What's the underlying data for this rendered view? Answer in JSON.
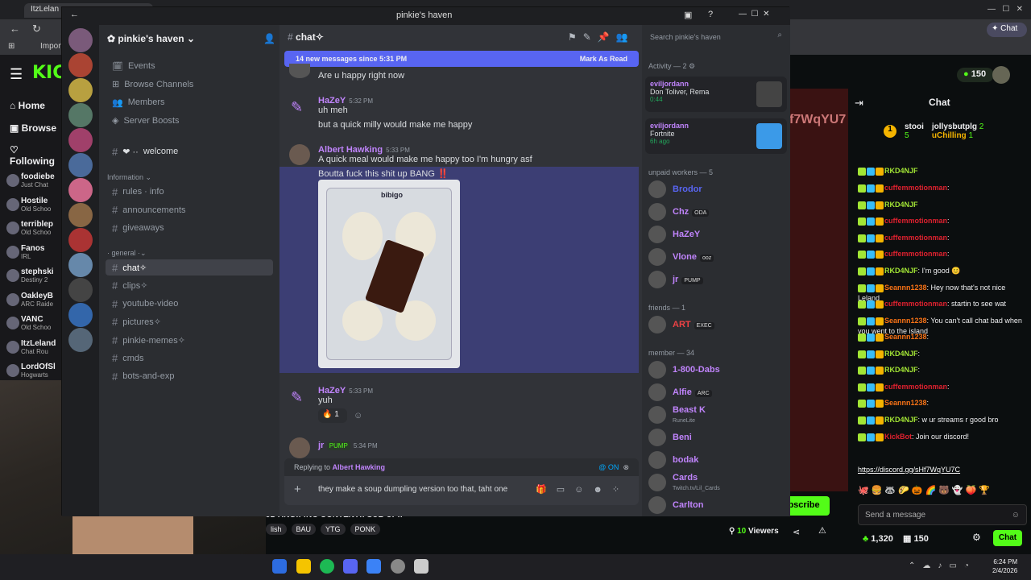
{
  "browser": {
    "tab_title": "ItzLelan",
    "bookmark_import": "Import"
  },
  "kick": {
    "logo": "KICK",
    "nav": [
      "Home",
      "Browse",
      "Following"
    ],
    "following": [
      {
        "name": "foodiebe",
        "game": "Just Chat"
      },
      {
        "name": "Hostile",
        "game": "Old Schoo"
      },
      {
        "name": "terriblep",
        "game": "Old Schoo"
      },
      {
        "name": "Fanos",
        "game": "IRL"
      },
      {
        "name": "stephski",
        "game": "Destiny 2"
      },
      {
        "name": "OakleyB",
        "game": "ARC Raide"
      },
      {
        "name": "VANC",
        "game": "Old Schoo"
      },
      {
        "name": "ItzLeland",
        "game": "Chat Rou"
      },
      {
        "name": "LordOfSl",
        "game": "Hogwarts"
      }
    ],
    "points": "150",
    "chat_title": "Chat",
    "top_gifters": [
      {
        "rank": "1",
        "name": "stooi",
        "count": "5"
      },
      {
        "name": "jollysbutplg",
        "count": "2"
      },
      {
        "name": "uChilling",
        "count": "1"
      }
    ],
    "chat": [
      {
        "user": "RKD4NJF",
        "text": "",
        "color": "#a3e635"
      },
      {
        "user": "cuffemmotionman",
        "text": ":",
        "color": "#e0212f"
      },
      {
        "user": "RKD4NJF",
        "text": "",
        "color": "#a3e635"
      },
      {
        "user": "cuffemmotionman",
        "text": ":",
        "color": "#e0212f"
      },
      {
        "user": "cuffemmotionman",
        "text": ":",
        "color": "#e0212f"
      },
      {
        "user": "cuffemmotionman",
        "text": ":",
        "color": "#e0212f"
      },
      {
        "user": "RKD4NJF",
        "text": ": I'm good 😊",
        "color": "#a3e635"
      },
      {
        "user": "Seannn1238",
        "text": ": Hey now that's not nice Leland",
        "color": "#f97316"
      },
      {
        "user": "cuffemmotionman",
        "text": ": startin to see wat",
        "color": "#e0212f"
      },
      {
        "user": "Seannn1238",
        "text": ": You can't call chat bad when you went to the island",
        "color": "#f97316"
      },
      {
        "user": "Seannn1238",
        "text": ":",
        "color": "#f97316"
      },
      {
        "user": "RKD4NJF",
        "text": ":",
        "color": "#a3e635"
      },
      {
        "user": "RKD4NJF",
        "text": ":",
        "color": "#a3e635"
      },
      {
        "user": "cuffemmotionman",
        "text": ":",
        "color": "#e0212f"
      },
      {
        "user": "Seannn1238",
        "text": ":",
        "color": "#f97316"
      },
      {
        "user": "RKD4NJF",
        "text": ": w ur streams r good bro",
        "color": "#a3e635"
      },
      {
        "user": "KickBot",
        "text": ": Join our discord!",
        "color": "#e0212f"
      }
    ],
    "discord_link": "https://discord.gg/sHf7WqYU7C",
    "send_placeholder": "Send a message",
    "kick_points": "1,320",
    "kick_points2": "150",
    "chat_button": "Chat",
    "subscribe": "Subscribe",
    "viewers": "10",
    "viewers_label": "Viewers",
    "stream_ticker": "JDYING!! !NO CONTENT!! SUB UP!!",
    "stream_tags": [
      "lish",
      "BAU",
      "YTG",
      "PONK"
    ],
    "video_overlay": "f7WqYU7"
  },
  "discord": {
    "window_title": "pinkie's haven",
    "server_name": "pinkie's haven",
    "nav_items": [
      "Events",
      "Browse Channels",
      "Members",
      "Server Boosts"
    ],
    "welcome": "welcome",
    "cat_information": "Information",
    "info_channels": [
      "rules · info",
      "announcements",
      "giveaways"
    ],
    "cat_general": "general",
    "channels": [
      "chat✧",
      "clips✧",
      "youtube-video",
      "pictures✧",
      "pinkie-memes✧",
      "cmds",
      "bots-and-exp"
    ],
    "header_channel": "chat✧",
    "search_placeholder": "Search pinkie's haven",
    "new_messages": "14 new messages since 5:31 PM",
    "mark_read": "Mark As Read",
    "messages": [
      {
        "text": "Are u happy right now"
      },
      {
        "name": "HaZeY",
        "time": "5:32 PM",
        "lines": [
          "uh meh",
          "but a quick milly would make me happy"
        ]
      },
      {
        "name": "Albert Hawking",
        "time": "5:33 PM",
        "lines": [
          "A quick meal would make me happy too I'm hungry asf",
          "Boutta fuck this shit up BANG ‼️"
        ]
      },
      {
        "name": "HaZeY",
        "time": "5:33 PM",
        "lines": [
          "yuh"
        ],
        "reaction": "🔥",
        "reaction_count": "1"
      },
      {
        "name": "jr",
        "badge": "PUMP",
        "time": "5:34 PM"
      }
    ],
    "image_label": "bibigo",
    "replying_prefix": "Replying to",
    "replying_to": "Albert Hawking",
    "mention_toggle": "@ ON",
    "composer_text": "they make a soup dumpling version too that, taht one",
    "activity_header": "Activity — 2",
    "activity": [
      {
        "user": "eviljordann",
        "title": "Don Toliver, Rema",
        "sub": "0:44"
      },
      {
        "user": "eviljordann",
        "title": "Fortnite",
        "sub": "6h ago"
      }
    ],
    "cat_unpaid": "unpaid workers — 5",
    "unpaid": [
      {
        "name": "Brodor",
        "color": "#5865f2"
      },
      {
        "name": "Chz",
        "tag": "ODA",
        "color": "#c084fc"
      },
      {
        "name": "HaZeY",
        "color": "#c084fc"
      },
      {
        "name": "Vlone",
        "tag": "ooz",
        "color": "#c084fc"
      },
      {
        "name": "jr",
        "tag": "PUMP",
        "color": "#c084fc"
      }
    ],
    "cat_friends": "friends — 1",
    "friends": [
      {
        "name": "ART",
        "tag": "EXEC",
        "color": "#ed4245"
      }
    ],
    "cat_member": "member — 34",
    "members": [
      {
        "name": "1-800-Dabs",
        "color": "#c084fc"
      },
      {
        "name": "Alfie",
        "tag": "ARC",
        "color": "#c084fc"
      },
      {
        "name": "Beast K",
        "sub": "RuneLite",
        "color": "#c084fc"
      },
      {
        "name": "Beni",
        "color": "#c084fc"
      },
      {
        "name": "bodak",
        "color": "#c084fc"
      },
      {
        "name": "Cards",
        "sub": "Twitch.tv/Lil_Cards",
        "color": "#c084fc"
      },
      {
        "name": "Carlton",
        "color": "#c084fc"
      }
    ]
  },
  "taskbar": {
    "time": "6:24 PM",
    "date": "2/4/2026"
  }
}
